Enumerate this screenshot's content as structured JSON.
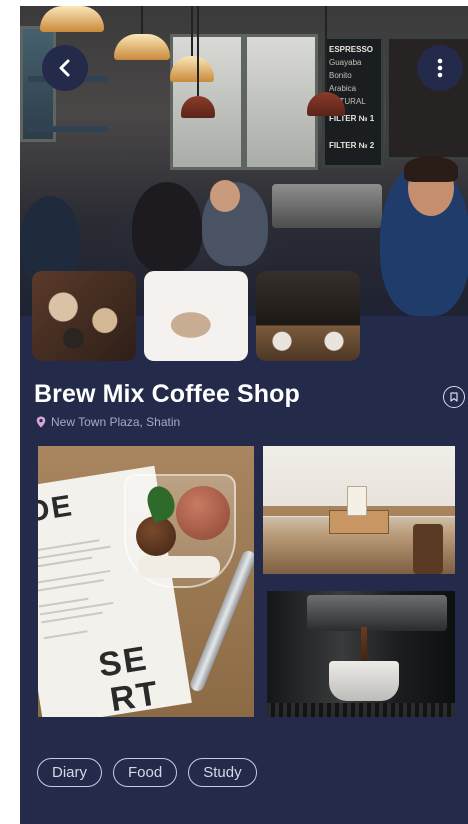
{
  "hero": {
    "back_icon": "chevron-left-icon",
    "menu_icon": "more-vertical-icon",
    "chalkboard_1": [
      "ESPRESSO",
      "Guayaba",
      "Bonito",
      "Arabica",
      "NATURAL"
    ],
    "chalkboard_2": [
      "FILTER № 1",
      "FILTER № 2"
    ]
  },
  "gallery_thumbs": [
    {
      "name": "latte-top-view"
    },
    {
      "name": "cappuccino-cup"
    },
    {
      "name": "pour-over-brew"
    }
  ],
  "shop": {
    "name": "Brew Mix Coffee Shop",
    "location": "New Town Plaza, Shatin",
    "location_icon": "map-pin-icon",
    "bookmark_icon": "bookmark-icon"
  },
  "dessert_menu_letters": {
    "line1": "DE",
    "line2": "SE",
    "line3": "RT"
  },
  "tags": [
    "Diary",
    "Food",
    "Study"
  ],
  "colors": {
    "background": "#232a4a",
    "text_primary": "#ffffff",
    "text_secondary": "#a5abc4",
    "pin": "#d8a6d4",
    "tag_border": "#c8cbdb"
  }
}
